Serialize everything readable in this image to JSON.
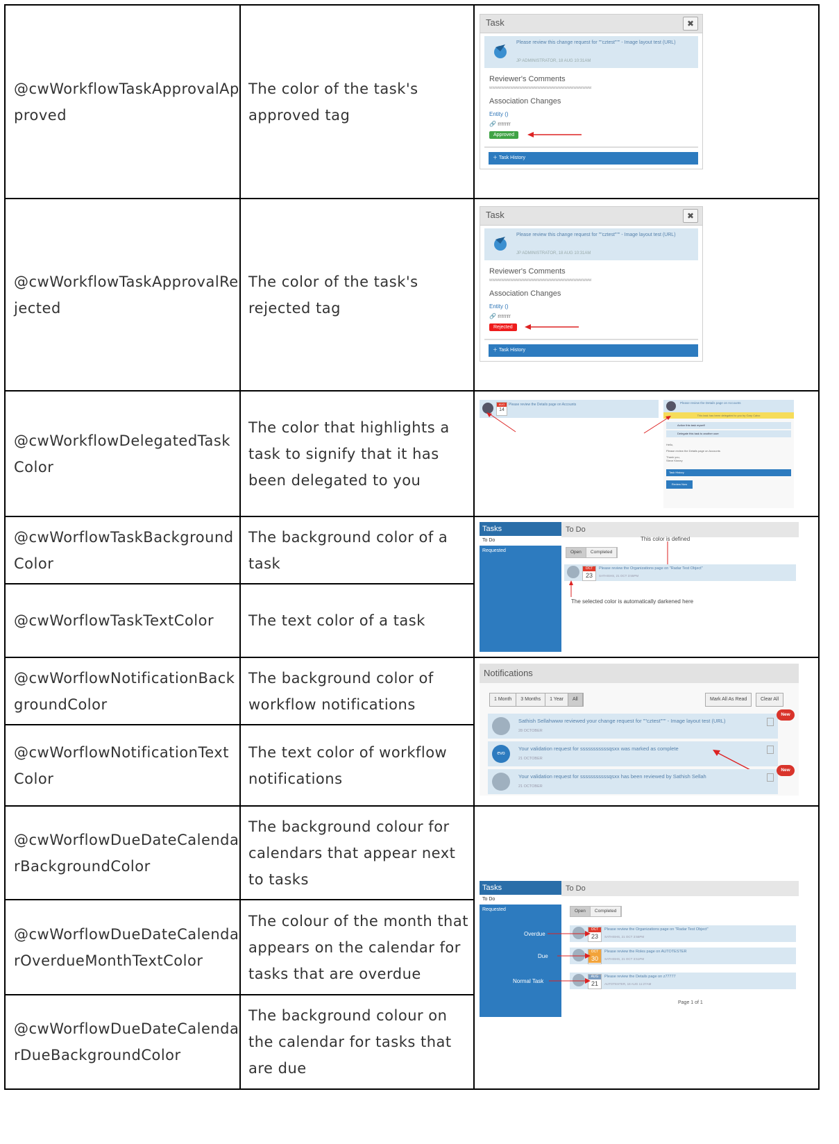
{
  "rows": [
    {
      "variable": "@cwWorkflowTaskApprovalApproved",
      "description": "The color of the task's approved tag"
    },
    {
      "variable": "@cwWorkflowTaskApprovalRejected",
      "description": "The color of the task's rejected tag"
    },
    {
      "variable": "@cwWorkflowDelegatedTaskColor",
      "description": "The color that highlights a task to signify that it has been delegated to you"
    },
    {
      "variable": "@cwWorflowTaskBackgroundColor",
      "description": "The background color of a task"
    },
    {
      "variable": "@cwWorflowTaskTextColor",
      "description": "The text color of a task"
    },
    {
      "variable": "@cwWorflowNotificationBackgroundColor",
      "description": "The background color of workflow notifications"
    },
    {
      "variable": "@cwWorflowNotificationTextColor",
      "description": "The text color of workflow notifications"
    },
    {
      "variable": "@cwWorflowDueDateCalendarBackgroundColor",
      "description": "The background colour for calendars that appear next to tasks"
    },
    {
      "variable": "@cwWorflowDueDateCalendarOverdueMonthTextColor",
      "description": "The colour of the month that appears on the calendar for tasks that are overdue"
    },
    {
      "variable": "@cwWorflowDueDateCalendarDueBackgroundColor",
      "description": "The background colour on the calendar for tasks that are due"
    }
  ],
  "task_dialog": {
    "title": "Task",
    "close": "✖",
    "message": "Please review this change request for \"\"cztest\"\"\" - Image layout test (URL)",
    "meta": "JP ADMINISTRATOR, 18 AUG 10:31AM",
    "comments_heading": "Reviewer's Comments",
    "comments_text": "wwwwwwwwwwwwwwwwwwwwwwwwwwwwwwwwww",
    "changes_heading": "Association Changes",
    "entity": "Entity ()",
    "chain": "rrrrrrr",
    "approved_tag": "Approved",
    "rejected_tag": "Rejected",
    "history": "Task History"
  },
  "delegated": {
    "month": "AUG",
    "day": "14",
    "left_text": "Please review the Details page on Accounts",
    "right_title": "Please review the Details page on Accounts",
    "banner": "This task has been delegated to you by Gary Calvo",
    "opt1": "Action this task myself",
    "opt2": "Delegate this task to another user",
    "hello": "Hello,",
    "body": "Please review the Details page on Accounts",
    "thanks": "Thank you,",
    "sign": "Steve Kinney",
    "history": "Task History",
    "review": "Review Now"
  },
  "tasks1": {
    "side_title": "Tasks",
    "todo": "To Do",
    "requested": "Requested",
    "head": "To Do",
    "tab_open": "Open",
    "tab_completed": "Completed",
    "row_month": "OCT",
    "row_day": "23",
    "row_text": "Please review the Organizations page on \"Radar Test Object\"",
    "row_meta": "SATHISHS, 21 OCT 3:55PM",
    "anno_top": "This color is defined",
    "anno_bottom": "The selected color is automatically darkened here"
  },
  "notifications": {
    "title": "Notifications",
    "seg": [
      "1 Month",
      "3 Months",
      "1 Year",
      "All"
    ],
    "mark_read": "Mark All As Read",
    "clear_all": "Clear All",
    "new_badge": "New",
    "items": [
      {
        "text": "Sathish Sellahwww reviewed your change request for \"\"cztest\"\"\" - Image layout test (URL)",
        "meta": "28 OCTOBER"
      },
      {
        "text": "Your validation request for sssssssssssqsxx was marked as complete",
        "meta": "21 OCTOBER",
        "avatar": "evo"
      },
      {
        "text": "Your validation request for sssssssssssqsxx has been reviewed by Sathish Sellah",
        "meta": "21 OCTOBER"
      }
    ]
  },
  "tasks2": {
    "side_title": "Tasks",
    "todo": "To Do",
    "requested": "Requested",
    "head": "To Do",
    "tab_open": "Open",
    "tab_completed": "Completed",
    "labels": [
      "Overdue",
      "Due",
      "Normal Task"
    ],
    "rows": [
      {
        "month": "OCT",
        "day": "23",
        "text": "Please review the Organizations page on \"Radar Test Object\"",
        "meta": "SATHISHS, 21 OCT 3:55PM"
      },
      {
        "month": "OCT",
        "day": "30",
        "text": "Please review the Roles page on AUTOTESTER",
        "meta": "SATHISHS, 21 OCT 3:51PM"
      },
      {
        "month": "AUG",
        "day": "21",
        "text": "Please review the Details page on z77777",
        "meta": "AUTOTESTER, 18 AUG 11:27AM"
      }
    ],
    "pager": "Page 1 of 1"
  },
  "colors": {
    "approved": "#3fa345",
    "rejected": "#ee1c1c",
    "delegated": "#f6dc5a",
    "task_bg": "#d8e7f2",
    "overdue_month": "#e03a2b",
    "due_bg": "#f2a33a",
    "sidebar": "#2d7bbf",
    "arrow": "#d22"
  }
}
